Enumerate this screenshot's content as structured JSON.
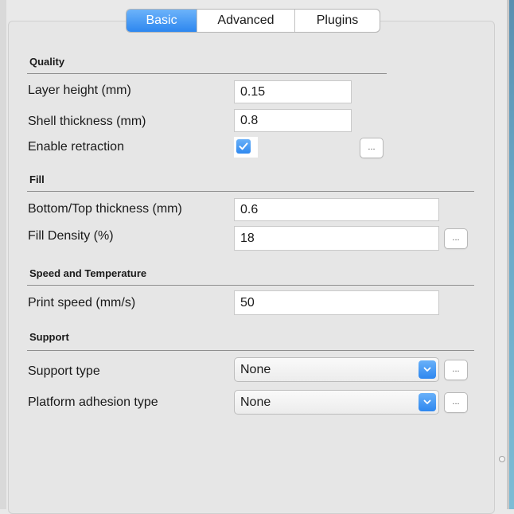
{
  "tabs": [
    {
      "label": "Basic",
      "active": true
    },
    {
      "label": "Advanced",
      "active": false
    },
    {
      "label": "Plugins",
      "active": false
    }
  ],
  "sections": {
    "quality": {
      "title": "Quality",
      "layer_height_label": "Layer height (mm)",
      "layer_height_value": "0.15",
      "shell_thickness_label": "Shell thickness (mm)",
      "shell_thickness_value": "0.8",
      "enable_retraction_label": "Enable retraction",
      "enable_retraction_checked": true
    },
    "fill": {
      "title": "Fill",
      "bottom_top_label": "Bottom/Top thickness (mm)",
      "bottom_top_value": "0.6",
      "fill_density_label": "Fill Density (%)",
      "fill_density_value": "18"
    },
    "speed": {
      "title": "Speed and Temperature",
      "print_speed_label": "Print speed (mm/s)",
      "print_speed_value": "50"
    },
    "support": {
      "title": "Support",
      "support_type_label": "Support type",
      "support_type_value": "None",
      "adhesion_label": "Platform adhesion type",
      "adhesion_value": "None"
    }
  },
  "more_button_label": "...",
  "colors": {
    "accent": "#2d87ef",
    "accent_light": "#6cb3fa",
    "panel": "#e6e6e6",
    "background": "#e9e9e9"
  },
  "icons": {
    "checkbox": "checkmark-icon",
    "select_arrow": "chevron-down-icon"
  }
}
